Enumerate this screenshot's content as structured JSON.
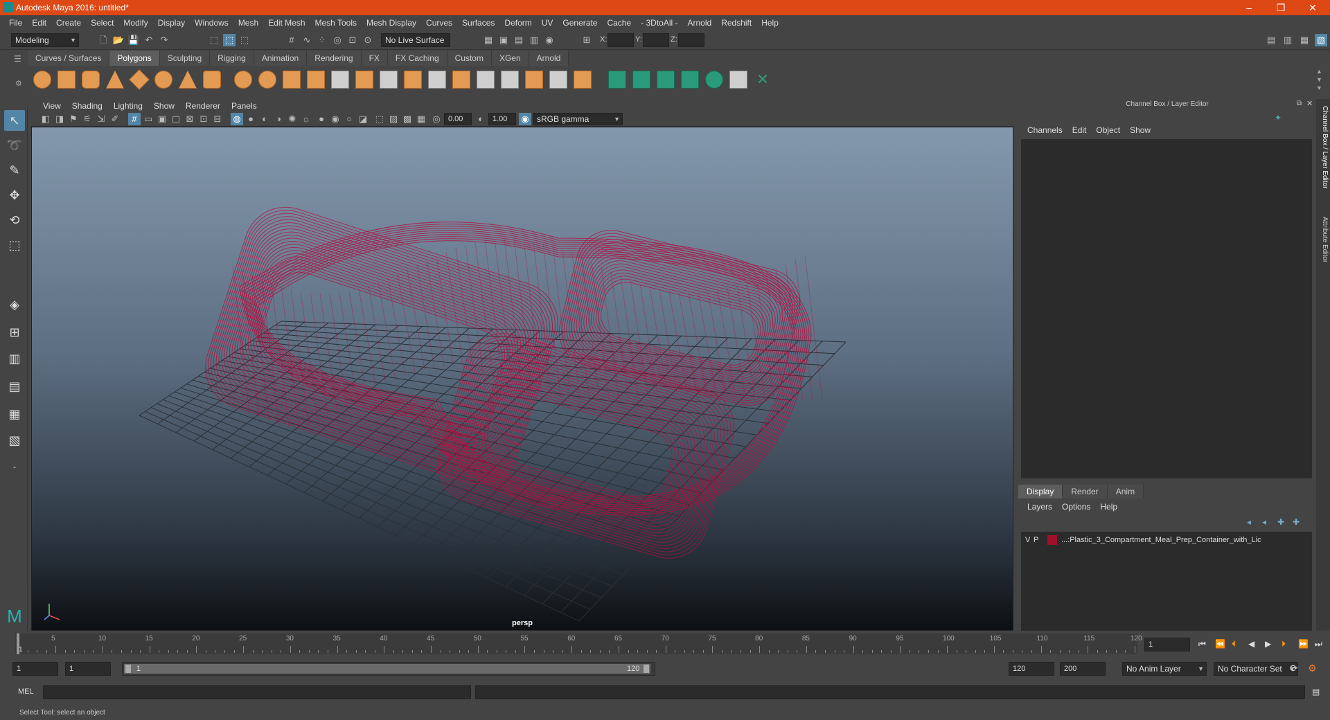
{
  "window": {
    "title": "Autodesk Maya 2016: untitled*",
    "minimize": "–",
    "restore": "❐",
    "close": "✕"
  },
  "menu": [
    "File",
    "Edit",
    "Create",
    "Select",
    "Modify",
    "Display",
    "Windows",
    "Mesh",
    "Edit Mesh",
    "Mesh Tools",
    "Mesh Display",
    "Curves",
    "Surfaces",
    "Deform",
    "UV",
    "Generate",
    "Cache",
    "- 3DtoAll -",
    "Arnold",
    "Redshift",
    "Help"
  ],
  "statusline": {
    "menu_set": "Modeling",
    "live_surface": "No Live Surface",
    "x_label": "X:",
    "y_label": "Y:",
    "z_label": "Z:"
  },
  "shelf_tabs": [
    "Curves / Surfaces",
    "Polygons",
    "Sculpting",
    "Rigging",
    "Animation",
    "Rendering",
    "FX",
    "FX Caching",
    "Custom",
    "XGen",
    "Arnold"
  ],
  "shelf_active": "Polygons",
  "viewport": {
    "menu": [
      "View",
      "Shading",
      "Lighting",
      "Show",
      "Renderer",
      "Panels"
    ],
    "exposure": "0.00",
    "gamma": "1.00",
    "color_space": "sRGB gamma",
    "camera_label": "persp",
    "wire_color": "#b0103e"
  },
  "channel_box": {
    "title": "Channel Box / Layer Editor",
    "menu": [
      "Channels",
      "Edit",
      "Object",
      "Show"
    ],
    "layer_tabs": [
      "Display",
      "Render",
      "Anim"
    ],
    "layer_menu": [
      "Layers",
      "Options",
      "Help"
    ],
    "layer": {
      "v": "V",
      "p": "P",
      "color": "#a0102c",
      "name": "...:Plastic_3_Compartment_Meal_Prep_Container_with_Lic"
    }
  },
  "side_tabs": [
    "Channel Box / Layer Editor",
    "Attribute Editor"
  ],
  "timeline": {
    "labels": [
      "5",
      "10",
      "15",
      "20",
      "25",
      "30",
      "35",
      "40",
      "45",
      "50",
      "55",
      "60",
      "65",
      "70",
      "75",
      "80",
      "85",
      "90",
      "95",
      "100",
      "105",
      "110",
      "115",
      "120"
    ],
    "start": "1",
    "current_frame": "1"
  },
  "range": {
    "start": "1",
    "playback_start": "1",
    "slider_start": "1",
    "slider_end": "120",
    "playback_end": "120",
    "end": "200",
    "anim_layer": "No Anim Layer",
    "char_set": "No Character Set"
  },
  "cmd": {
    "lang": "MEL"
  },
  "help_text": "Select Tool: select an object"
}
